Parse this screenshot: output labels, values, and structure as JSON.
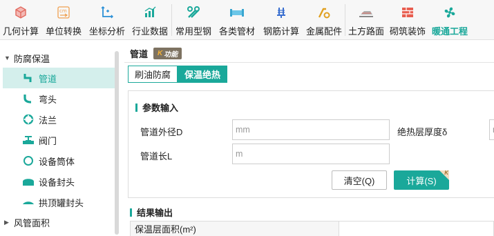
{
  "toolbar": {
    "items": [
      {
        "label": "几何计算",
        "icon": "cube-icon"
      },
      {
        "label": "单位转换",
        "icon": "unit-convert-icon"
      },
      {
        "label": "坐标分析",
        "icon": "axis-icon"
      },
      {
        "label": "行业数据",
        "icon": "bar-chart-icon"
      },
      {
        "label": "常用型钢",
        "icon": "wrench-icon"
      },
      {
        "label": "各类管材",
        "icon": "pipe-icon"
      },
      {
        "label": "钢筋计算",
        "icon": "rebar-icon"
      },
      {
        "label": "金属配件",
        "icon": "metal-fitting-icon"
      },
      {
        "label": "土方路面",
        "icon": "road-icon"
      },
      {
        "label": "砌筑装饰",
        "icon": "brick-icon"
      },
      {
        "label": "暖通工程",
        "icon": "fan-icon"
      }
    ],
    "active_color": "#1aa89a"
  },
  "sidebar": {
    "group1": "防腐保温",
    "items": [
      {
        "label": "管道",
        "icon": "pipe-elbow-icon"
      },
      {
        "label": "弯头",
        "icon": "bend-icon"
      },
      {
        "label": "法兰",
        "icon": "flange-icon"
      },
      {
        "label": "阀门",
        "icon": "valve-icon"
      },
      {
        "label": "设备筒体",
        "icon": "cylinder-icon"
      },
      {
        "label": "设备封头",
        "icon": "head-cap-icon"
      },
      {
        "label": "拱顶罐封头",
        "icon": "dome-cap-icon"
      }
    ],
    "group2": "风管面积"
  },
  "main": {
    "title": "管道",
    "badge": "功能",
    "badge_k": "K",
    "tabs": [
      "刷油防腐",
      "保温绝热"
    ],
    "input_section": "参数输入",
    "fields": {
      "outer_diameter_label": "管道外径D",
      "outer_diameter_placeholder": "mm",
      "insulation_label": "绝热层厚度δ",
      "insulation_placeholder": "mm",
      "length_label": "管道长L",
      "length_placeholder": "m"
    },
    "clear_button": "清空(Q)",
    "calc_button": "计算(S)",
    "calc_corner": "K",
    "output_section": "结果输出",
    "output_row_label": "保温层面积(m²)"
  }
}
